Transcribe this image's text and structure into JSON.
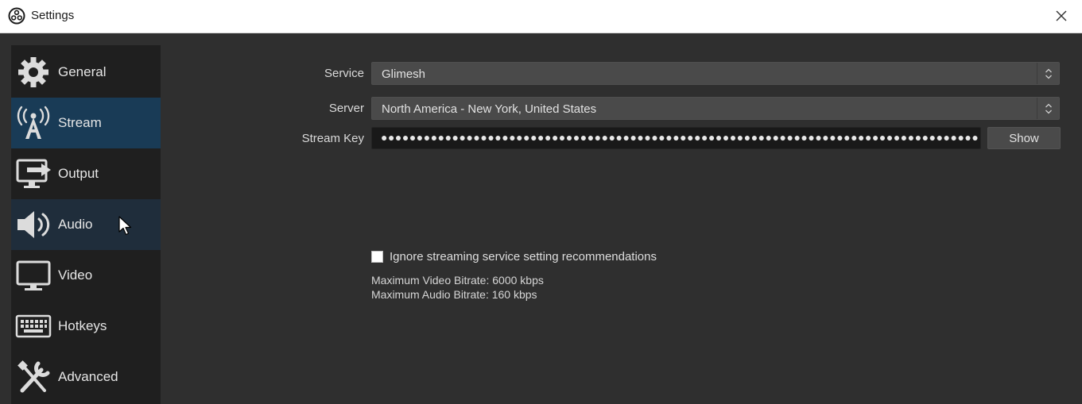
{
  "window": {
    "title": "Settings",
    "title_icon": "obs-logo-icon",
    "close_icon": "close-icon"
  },
  "sidebar": {
    "items": [
      {
        "label": "General",
        "icon": "gear-icon",
        "state": "normal"
      },
      {
        "label": "Stream",
        "icon": "broadcast-antenna-icon",
        "state": "active"
      },
      {
        "label": "Output",
        "icon": "output-monitor-icon",
        "state": "normal"
      },
      {
        "label": "Audio",
        "icon": "speaker-icon",
        "state": "hover"
      },
      {
        "label": "Video",
        "icon": "monitor-icon",
        "state": "normal"
      },
      {
        "label": "Hotkeys",
        "icon": "keyboard-icon",
        "state": "normal"
      },
      {
        "label": "Advanced",
        "icon": "wrench-screwdriver-icon",
        "state": "normal"
      }
    ]
  },
  "stream": {
    "service_label": "Service",
    "service_value": "Glimesh",
    "server_label": "Server",
    "server_value": "North America - New York, United States",
    "key_label": "Stream Key",
    "key_masked": "●●●●●●●●●●●●●●●●●●●●●●●●●●●●●●●●●●●●●●●●●●●●●●●●●●●●●●●●●●●●●●●●●●●●●●●●●●●●●●●●●●●●",
    "show_button": "Show",
    "ignore_label": "Ignore streaming service setting recommendations",
    "ignore_checked": false,
    "max_video_bitrate": "Maximum Video Bitrate: 6000 kbps",
    "max_audio_bitrate": "Maximum Audio Bitrate: 160 kbps"
  },
  "colors": {
    "background": "#2f2f2f",
    "sidebar": "#1f1f1f",
    "active_item": "#193b56",
    "input_dark": "#191919",
    "select_bg": "#4a4a4a"
  }
}
